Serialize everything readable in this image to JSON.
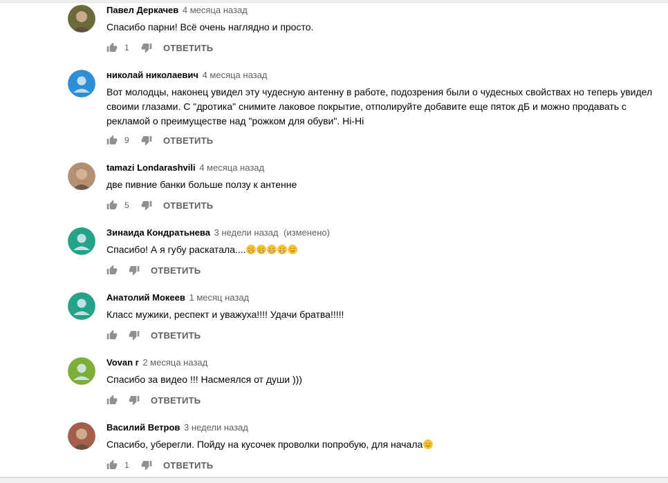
{
  "ui": {
    "reply_label": "ОТВЕТИТЬ"
  },
  "comments": [
    {
      "author": "Павел Деркачев",
      "time": "4 месяца назад",
      "edited": "",
      "text": "Спасибо парни!  Всё очень наглядно и просто.",
      "likes": "1",
      "emojis": [],
      "avatar": {
        "type": "photo",
        "color": "#6b6a3c"
      }
    },
    {
      "author": "николай николаевич",
      "time": "4 месяца назад",
      "edited": "",
      "text": "Вот молодцы, наконец увидел эту чудесную антенну в работе, подозрения были о чудесных свойствах но теперь увидел своими глазами.  С \"дротика\" снимите лаковое покрытие,  отполируйте добавите еще пяток дБ и можно продавать с рекламой о преимуществе над \"рожком для обуви\". Hi-Hi",
      "likes": "9",
      "emojis": [],
      "avatar": {
        "type": "default",
        "color": "#2e8fd6"
      }
    },
    {
      "author": "tamazi Londarashvili",
      "time": "4 месяца назад",
      "edited": "",
      "text": "две пивние банки больше ползу к антенне",
      "likes": "5",
      "emojis": [],
      "avatar": {
        "type": "photo",
        "color": "#b58e74"
      }
    },
    {
      "author": "Зинаида Кондратьнева",
      "time": "3 недели назад",
      "edited": "(изменено)",
      "text": "Спасибо! А я губу раскатала....",
      "likes": "",
      "emojis": [
        "grin-emoji",
        "grin-emoji",
        "grin-emoji",
        "grin-emoji",
        "smile-emoji"
      ],
      "avatar": {
        "type": "default",
        "color": "#26a287"
      }
    },
    {
      "author": "Анатолий Мокеев",
      "time": "1 месяц назад",
      "edited": "",
      "text": "Класс мужики, респект и уважуха!!!! Удачи братва!!!!!",
      "likes": "",
      "emojis": [],
      "avatar": {
        "type": "default",
        "color": "#26a287"
      }
    },
    {
      "author": "Vovan r",
      "time": "2 месяца назад",
      "edited": "",
      "text": "Спасибо за видео !!! Насмеялся от души )))",
      "likes": "",
      "emojis": [],
      "avatar": {
        "type": "default",
        "color": "#7cae39"
      }
    },
    {
      "author": "Василий Ветров",
      "time": "3 недели назад",
      "edited": "",
      "text": "Спасибо, уберегли. Пойду на кусочек проволки попробую, для начала",
      "likes": "1",
      "emojis": [
        "smile-emoji"
      ],
      "avatar": {
        "type": "photo",
        "color": "#a45f4c"
      }
    }
  ]
}
